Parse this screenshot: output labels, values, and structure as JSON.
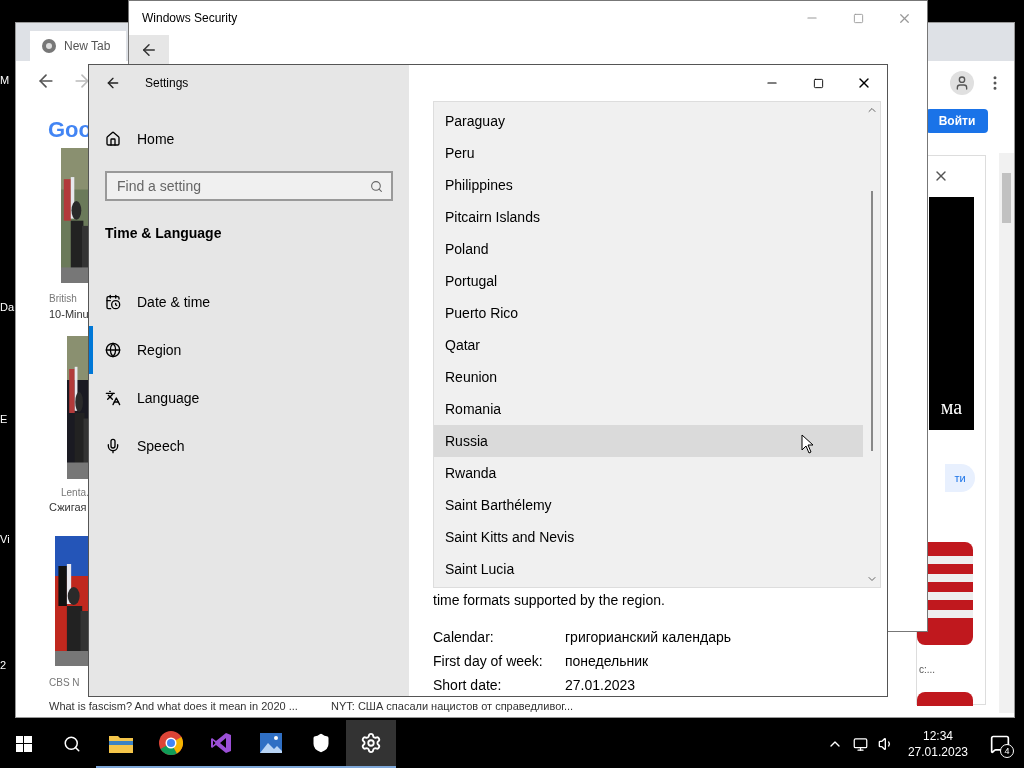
{
  "desktop": {
    "icon_labels": [
      "M",
      "Da",
      "E",
      "Vi",
      "2"
    ]
  },
  "browser": {
    "tab": "New Tab",
    "logo": "Goo",
    "sign_in": "Войти",
    "news": [
      {
        "source": "British",
        "headline": "10-Minu"
      },
      {
        "source": "Lenta.",
        "headline": "Сжигая"
      },
      {
        "source": "CBS N",
        "headline": "What is fascism? And what does it mean in 2020 ..."
      }
    ],
    "news_more": "NYT: США спасали нацистов от справедливог...",
    "side_panel": {
      "image_caption": "ма",
      "button": "ти",
      "snippet": "с:..."
    }
  },
  "security": {
    "title": "Windows Security"
  },
  "settings": {
    "title": "Settings",
    "home": "Home",
    "search": {
      "placeholder": "Find a setting"
    },
    "section": "Time & Language",
    "nav": [
      {
        "label": "Date & time",
        "selected": false
      },
      {
        "label": "Region",
        "selected": true
      },
      {
        "label": "Language",
        "selected": false
      },
      {
        "label": "Speech",
        "selected": false
      }
    ],
    "countries": [
      {
        "name": "Paraguay",
        "selected": false
      },
      {
        "name": "Peru",
        "selected": false
      },
      {
        "name": "Philippines",
        "selected": false
      },
      {
        "name": "Pitcairn Islands",
        "selected": false
      },
      {
        "name": "Poland",
        "selected": false
      },
      {
        "name": "Portugal",
        "selected": false
      },
      {
        "name": "Puerto Rico",
        "selected": false
      },
      {
        "name": "Qatar",
        "selected": false
      },
      {
        "name": "Reunion",
        "selected": false
      },
      {
        "name": "Romania",
        "selected": false
      },
      {
        "name": "Russia",
        "selected": true
      },
      {
        "name": "Rwanda",
        "selected": false
      },
      {
        "name": "Saint Barthélemy",
        "selected": false
      },
      {
        "name": "Saint Kitts and Nevis",
        "selected": false
      },
      {
        "name": "Saint Lucia",
        "selected": false
      }
    ],
    "note": "time formats supported by the region.",
    "formats": [
      {
        "label": "Calendar:",
        "value": "григорианский календарь"
      },
      {
        "label": "First day of week:",
        "value": "понедельник"
      },
      {
        "label": "Short date:",
        "value": "27.01.2023"
      }
    ]
  },
  "taskbar": {
    "time": "12:34",
    "date": "27.01.2023",
    "notifications": "4"
  }
}
